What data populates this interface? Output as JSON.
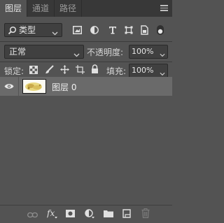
{
  "tabs": [
    {
      "label": "图层",
      "active": true
    },
    {
      "label": "通道",
      "active": false
    },
    {
      "label": "路径",
      "active": false
    }
  ],
  "filter": {
    "kind_label": "类型",
    "icons": [
      "pixel-filter-icon",
      "adjustment-filter-icon",
      "type-filter-icon",
      "shape-filter-icon",
      "smart-object-filter-icon",
      "filter-toggle-icon"
    ]
  },
  "blend": {
    "mode": "正常",
    "opacity_label": "不透明度:",
    "opacity_value": "100%"
  },
  "lock": {
    "label": "锁定:",
    "icons": [
      "lock-transparent-icon",
      "lock-image-icon",
      "lock-position-icon",
      "lock-artboard-icon",
      "lock-all-icon"
    ],
    "fill_label": "填充:",
    "fill_value": "100%"
  },
  "layers": [
    {
      "name": "图层 0",
      "visible": true,
      "selected": true
    }
  ],
  "bottom_icons": [
    "link-layers-icon",
    "fx-icon",
    "add-mask-icon",
    "adjustment-layer-icon",
    "new-group-icon",
    "new-layer-icon",
    "delete-layer-icon"
  ],
  "colors": {
    "panel": "#535353",
    "tabbar": "#383838",
    "selected_row": "#6a6a6a",
    "field": "#404040"
  }
}
